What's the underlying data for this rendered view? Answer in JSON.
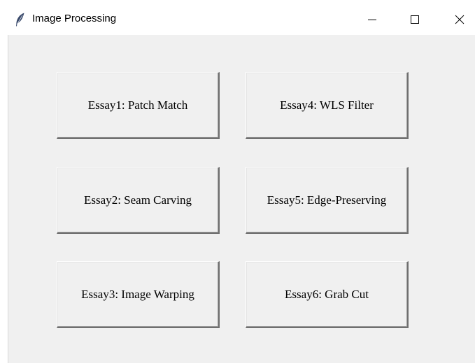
{
  "window": {
    "title": "Image Processing",
    "app_icon": "feather-icon",
    "controls": {
      "minimize_icon": "minimize-icon",
      "maximize_icon": "maximize-icon",
      "close_icon": "close-icon"
    }
  },
  "buttons": [
    {
      "label": "Essay1: Patch Match"
    },
    {
      "label": "Essay2: Seam Carving"
    },
    {
      "label": "Essay3: Image Warping"
    },
    {
      "label": "Essay4: WLS Filter"
    },
    {
      "label": "Essay5: Edge-Preserving"
    },
    {
      "label": "Essay6: Grab Cut"
    }
  ],
  "colors": {
    "client_background": "#f0f0f0",
    "titlebar_background": "#ffffff",
    "feather_icon": "#3a4a6b"
  }
}
